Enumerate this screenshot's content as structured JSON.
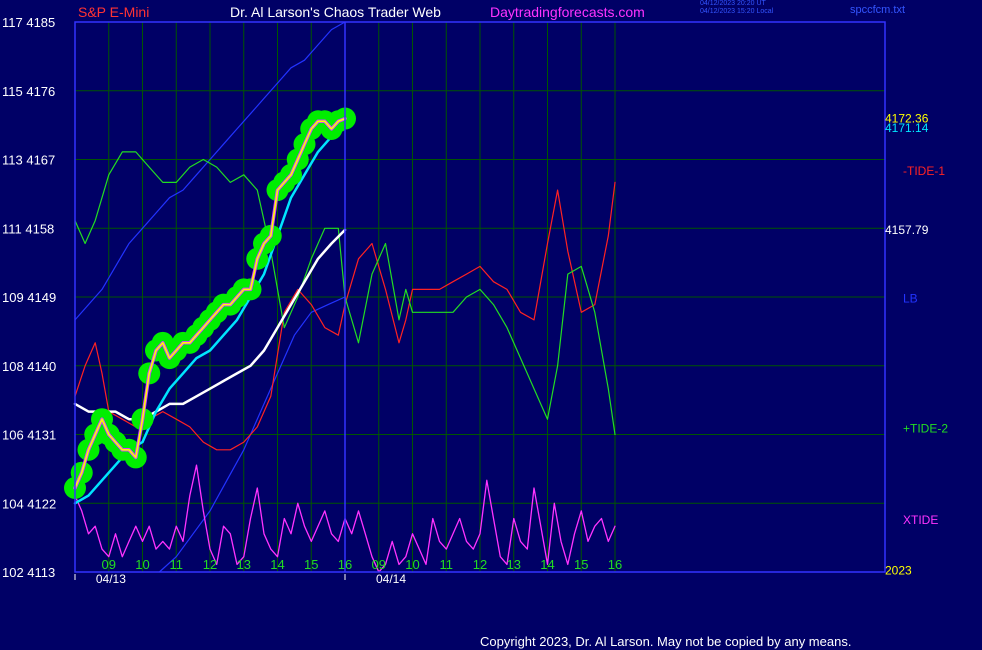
{
  "header": {
    "left": "S&P E-Mini",
    "center": "Dr. Al Larson's Chaos Trader Web",
    "site": "Daytradingforecasts.com",
    "stamp_line1": "04/12/2023 20:20 UT",
    "stamp_line2": "04/12/2023 15:20 Local",
    "file": "spccfcm.txt"
  },
  "colors": {
    "background": "#000066",
    "frame": "#3333ff",
    "grid": "#005500",
    "price": "#ffff00",
    "price_halo": "#00ee00",
    "fast_ma": "#00e5ff",
    "slow_ma": "#ffffff",
    "tide_1": "#ff2222",
    "tide_2": "#22dd22",
    "lb": "#2233ff",
    "xtide": "#ff33ff",
    "price_inner": "#cc44ff",
    "axis_text": "#ffffff",
    "header_left": "#ff3333",
    "header_center": "#ffffff",
    "header_site": "#ff33ff"
  },
  "footer": {
    "copyright": "Copyright 2023, Dr. Al Larson. May not be copied by any means."
  },
  "chart_data": {
    "type": "line",
    "title": "Dr. Al Larson's Chaos Trader Web",
    "x_axis": {
      "unit": "hour",
      "range": [
        8.0,
        32.0
      ],
      "hour_labels": [
        {
          "x": 9,
          "label": "09"
        },
        {
          "x": 10,
          "label": "10"
        },
        {
          "x": 11,
          "label": "11"
        },
        {
          "x": 12,
          "label": "12"
        },
        {
          "x": 13,
          "label": "13"
        },
        {
          "x": 14,
          "label": "14"
        },
        {
          "x": 15,
          "label": "15"
        },
        {
          "x": 16,
          "label": "16"
        },
        {
          "x": 17,
          "label": "09"
        },
        {
          "x": 18,
          "label": "10"
        },
        {
          "x": 19,
          "label": "11"
        },
        {
          "x": 20,
          "label": "12"
        },
        {
          "x": 21,
          "label": "13"
        },
        {
          "x": 22,
          "label": "14"
        },
        {
          "x": 23,
          "label": "15"
        },
        {
          "x": 24,
          "label": "16"
        }
      ],
      "date_labels": [
        {
          "x": 8.5,
          "label": "04/13"
        },
        {
          "x": 16.8,
          "label": "04/14"
        }
      ],
      "day_boundary": 16.0
    },
    "y_axis": {
      "range": [
        4113,
        4185
      ],
      "ticks": [
        {
          "price": 4185,
          "label": "117  4185"
        },
        {
          "price": 4176,
          "label": "115  4176"
        },
        {
          "price": 4167,
          "label": "113  4167"
        },
        {
          "price": 4158,
          "label": "111  4158"
        },
        {
          "price": 4149,
          "label": "109  4149"
        },
        {
          "price": 4140,
          "label": "108  4140"
        },
        {
          "price": 4131,
          "label": "106  4131"
        },
        {
          "price": 4122,
          "label": "104  4122"
        },
        {
          "price": 4113,
          "label": "102  4113"
        }
      ]
    },
    "right_labels": [
      {
        "text": "4172.36",
        "y": 4172.36,
        "series": "price"
      },
      {
        "text": "4171.14",
        "y": 4171.14,
        "series": "fast_ma"
      },
      {
        "text": "-TIDE-1",
        "y": 4165.5,
        "series": "tide_1"
      },
      {
        "text": "4157.79",
        "y": 4157.79,
        "series": "slow_ma"
      },
      {
        "text": "LB",
        "y": 4148.8,
        "series": "lb"
      },
      {
        "text": "+TIDE-2",
        "y": 4131.8,
        "series": "tide_2"
      },
      {
        "text": "XTIDE",
        "y": 4119.8,
        "series": "xtide"
      },
      {
        "text": "2023",
        "y": 4113.2,
        "series": "year"
      }
    ],
    "series": [
      {
        "name": "price",
        "x": [
          8.0,
          8.2,
          8.4,
          8.6,
          8.8,
          9.0,
          9.2,
          9.4,
          9.6,
          9.8,
          10.0,
          10.2,
          10.4,
          10.6,
          10.8,
          11.0,
          11.2,
          11.4,
          11.6,
          11.8,
          12.0,
          12.2,
          12.4,
          12.6,
          12.8,
          13.0,
          13.2,
          13.4,
          13.6,
          13.8,
          14.0,
          14.2,
          14.4,
          14.6,
          14.8,
          15.0,
          15.2,
          15.4,
          15.6,
          15.8,
          16.0
        ],
        "y": [
          4124,
          4126,
          4129,
          4131,
          4133,
          4131,
          4130,
          4129,
          4129,
          4128,
          4133,
          4139,
          4142,
          4143,
          4141,
          4142,
          4143,
          4143,
          4144,
          4145,
          4146,
          4147,
          4148,
          4148,
          4149,
          4150,
          4150,
          4154,
          4156,
          4157,
          4163,
          4164,
          4165,
          4167,
          4169,
          4171,
          4172,
          4172,
          4171,
          4172,
          4172.36
        ]
      },
      {
        "name": "fast_ma",
        "x": [
          8.0,
          8.4,
          8.8,
          9.2,
          9.6,
          10.0,
          10.4,
          10.8,
          11.2,
          11.6,
          12.0,
          12.4,
          12.8,
          13.2,
          13.6,
          14.0,
          14.4,
          14.8,
          15.2,
          15.6,
          16.0
        ],
        "y": [
          4122,
          4123,
          4125,
          4127,
          4129,
          4130,
          4134,
          4137,
          4139,
          4141,
          4142,
          4144,
          4146,
          4149,
          4152,
          4157,
          4162,
          4165,
          4168,
          4170,
          4171.14
        ]
      },
      {
        "name": "slow_ma",
        "x": [
          8.0,
          8.4,
          8.8,
          9.2,
          9.6,
          10.0,
          10.4,
          10.8,
          11.2,
          11.6,
          12.0,
          12.4,
          12.8,
          13.2,
          13.6,
          14.0,
          14.4,
          14.8,
          15.2,
          15.6,
          16.0
        ],
        "y": [
          4135,
          4134,
          4134,
          4134,
          4133,
          4133,
          4134,
          4135,
          4135,
          4136,
          4137,
          4138,
          4139,
          4140,
          4142,
          4145,
          4148,
          4151,
          4154,
          4156,
          4157.79
        ]
      },
      {
        "name": "-TIDE-1",
        "x": [
          8.0,
          8.3,
          8.6,
          8.8,
          9.0,
          9.4,
          9.8,
          10.2,
          10.6,
          11.0,
          11.4,
          11.8,
          12.2,
          12.6,
          13.0,
          13.4,
          13.8,
          14.2,
          14.6,
          15.0,
          15.4,
          15.8,
          16.0,
          16.4,
          16.8,
          17.2,
          17.6,
          17.8,
          18.0,
          18.4,
          18.8,
          19.2,
          19.6,
          20.0,
          20.4,
          20.8,
          21.2,
          21.6,
          22.0,
          22.3,
          22.6,
          23.0,
          23.4,
          23.8,
          24.0
        ],
        "y": [
          4136,
          4140,
          4143,
          4139,
          4134,
          4133,
          4132,
          4133,
          4134,
          4133,
          4132,
          4130,
          4129,
          4129,
          4130,
          4132,
          4136,
          4147,
          4150,
          4148,
          4145,
          4144,
          4148,
          4154,
          4156,
          4150,
          4143,
          4146,
          4150,
          4150,
          4150,
          4151,
          4152,
          4153,
          4151,
          4150,
          4147,
          4146,
          4156,
          4163,
          4155,
          4147,
          4148,
          4157,
          4164
        ]
      },
      {
        "name": "+TIDE-2",
        "x": [
          8.0,
          8.3,
          8.6,
          9.0,
          9.4,
          9.8,
          10.2,
          10.6,
          11.0,
          11.4,
          11.8,
          12.2,
          12.6,
          13.0,
          13.4,
          13.8,
          14.2,
          14.6,
          15.0,
          15.4,
          15.8,
          16.0,
          16.4,
          16.8,
          17.2,
          17.6,
          17.8,
          18.0,
          18.4,
          18.8,
          19.2,
          19.6,
          20.0,
          20.4,
          20.8,
          21.2,
          21.6,
          22.0,
          22.3,
          22.6,
          23.0,
          23.4,
          23.8,
          24.0
        ],
        "y": [
          4159,
          4156,
          4159,
          4165,
          4168,
          4168,
          4166,
          4164,
          4164,
          4166,
          4167,
          4166,
          4164,
          4165,
          4163,
          4155,
          4145,
          4149,
          4154,
          4158,
          4158,
          4149,
          4143,
          4152,
          4156,
          4146,
          4150,
          4147,
          4147,
          4147,
          4147,
          4149,
          4150,
          4148,
          4145,
          4141,
          4137,
          4133,
          4140,
          4152,
          4153,
          4147,
          4137,
          4131
        ]
      },
      {
        "name": "LB",
        "x": [
          8.0,
          8.4,
          8.8,
          9.2,
          9.6,
          10.0,
          10.4,
          10.8,
          11.2,
          11.6,
          12.0,
          12.4,
          12.8,
          13.2,
          13.6,
          14.0,
          14.4,
          14.8,
          15.2,
          15.6,
          16.0
        ],
        "y": [
          4146,
          4148,
          4150,
          4153,
          4156,
          4158,
          4160,
          4162,
          4163,
          4165,
          4167,
          4169,
          4171,
          4173,
          4175,
          4177,
          4179,
          4180,
          4182,
          4184,
          4185
        ]
      },
      {
        "name": "LB-low",
        "x": [
          10.5,
          11.0,
          11.5,
          12.0,
          12.5,
          13.0,
          13.5,
          14.0,
          14.5,
          15.0,
          15.5,
          16.0
        ],
        "y": [
          4113,
          4115,
          4118,
          4121,
          4125,
          4129,
          4134,
          4139,
          4144,
          4147,
          4148,
          4149
        ]
      },
      {
        "name": "XTIDE",
        "x": [
          8.0,
          8.2,
          8.4,
          8.6,
          8.8,
          9.0,
          9.2,
          9.4,
          9.6,
          9.8,
          10.0,
          10.2,
          10.4,
          10.6,
          10.8,
          11.0,
          11.2,
          11.4,
          11.6,
          11.8,
          12.0,
          12.2,
          12.4,
          12.6,
          12.8,
          13.0,
          13.2,
          13.4,
          13.6,
          13.8,
          14.0,
          14.2,
          14.4,
          14.6,
          14.8,
          15.0,
          15.2,
          15.4,
          15.6,
          15.8,
          16.0,
          16.2,
          16.4,
          16.6,
          16.8,
          17.0,
          17.2,
          17.4,
          17.6,
          17.8,
          18.0,
          18.2,
          18.4,
          18.6,
          18.8,
          19.0,
          19.2,
          19.4,
          19.6,
          19.8,
          20.0,
          20.2,
          20.4,
          20.6,
          20.8,
          21.0,
          21.2,
          21.4,
          21.6,
          21.8,
          22.0,
          22.2,
          22.4,
          22.6,
          22.8,
          23.0,
          23.2,
          23.4,
          23.6,
          23.8,
          24.0
        ],
        "y": [
          4123,
          4121,
          4118,
          4119,
          4116,
          4115,
          4118,
          4115,
          4117,
          4119,
          4117,
          4119,
          4116,
          4117,
          4116,
          4119,
          4117,
          4123,
          4127,
          4121,
          4116,
          4114,
          4119,
          4118,
          4114,
          4115,
          4120,
          4124,
          4118,
          4116,
          4115,
          4120,
          4118,
          4122,
          4119,
          4117,
          4119,
          4121,
          4118,
          4117,
          4120,
          4118,
          4121,
          4118,
          4115,
          4113,
          4114,
          4117,
          4114,
          4115,
          4118,
          4116,
          4114,
          4120,
          4117,
          4116,
          4118,
          4120,
          4117,
          4116,
          4118,
          4125,
          4120,
          4115,
          4114,
          4120,
          4117,
          4116,
          4124,
          4119,
          4114,
          4122,
          4117,
          4114,
          4118,
          4121,
          4117,
          4119,
          4120,
          4117,
          4119
        ]
      }
    ]
  }
}
